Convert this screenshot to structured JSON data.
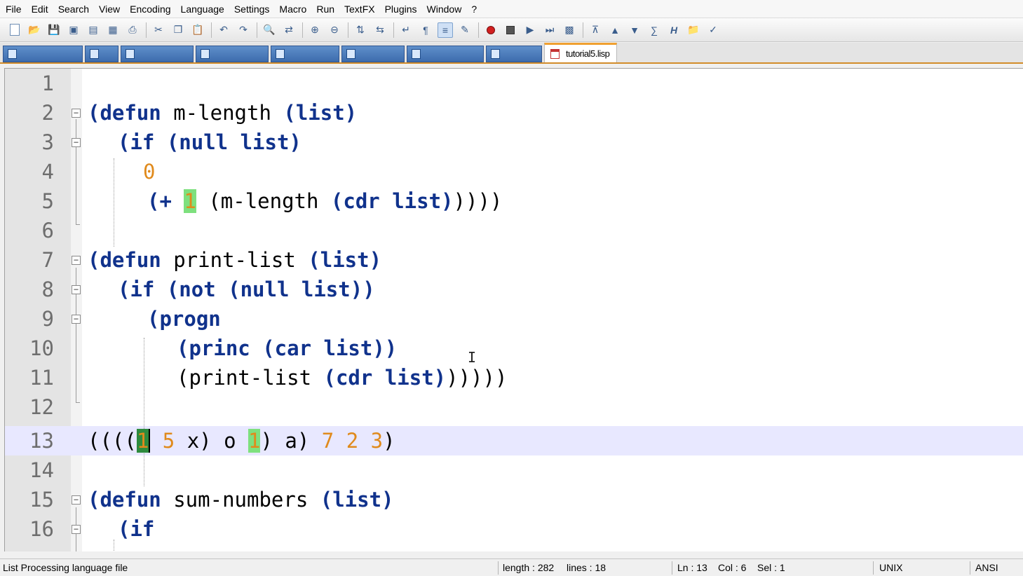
{
  "menubar": {
    "items": [
      "File",
      "Edit",
      "Search",
      "View",
      "Encoding",
      "Language",
      "Settings",
      "Macro",
      "Run",
      "TextFX",
      "Plugins",
      "Window",
      "?"
    ]
  },
  "tabs": {
    "active_label": "tutorial5.lisp"
  },
  "editor": {
    "lines": [
      {
        "n": "1"
      },
      {
        "n": "2"
      },
      {
        "n": "3"
      },
      {
        "n": "4"
      },
      {
        "n": "5"
      },
      {
        "n": "6"
      },
      {
        "n": "7"
      },
      {
        "n": "8"
      },
      {
        "n": "9"
      },
      {
        "n": "10"
      },
      {
        "n": "11"
      },
      {
        "n": "12"
      },
      {
        "n": "13"
      },
      {
        "n": "14"
      },
      {
        "n": "15"
      },
      {
        "n": "16"
      }
    ],
    "code": {
      "l2": {
        "open": "(defun",
        "name": " m-length ",
        "args": "(list)"
      },
      "l3": {
        "a": "(if (null list)"
      },
      "l4": {
        "a": "0"
      },
      "l5": {
        "a": "(+ ",
        "one": "1",
        "b": " (m-length ",
        "c": "(cdr list)",
        "d": "))))"
      },
      "l7": {
        "open": "(defun",
        "name": " print-list ",
        "args": "(list)"
      },
      "l8": {
        "a": "(if (not (null list))"
      },
      "l9": {
        "a": "(progn"
      },
      "l10": {
        "a": "(princ (car list))"
      },
      "l11": {
        "a": "(print-list ",
        "b": "(cdr list)",
        "c": ")))))"
      },
      "l13": {
        "a": "((((",
        "one": "1",
        "b": " ",
        "five": "5",
        "c": " x) o ",
        "one2": "1",
        "d": ") a) ",
        "seven": "7",
        "e": " ",
        "two": "2",
        "f": " ",
        "three": "3",
        "g": ")"
      },
      "l15": {
        "open": "(defun",
        "name": " sum-numbers ",
        "args": "(list)"
      },
      "l16": {
        "a": "(if"
      }
    },
    "current_line": 13
  },
  "statusbar": {
    "file_type": "List Processing language file",
    "length": "length : 282",
    "lines": "lines : 18",
    "ln": "Ln : 13",
    "col": "Col : 6",
    "sel": "Sel : 1",
    "eol": "UNIX",
    "encoding": "ANSI"
  },
  "colors": {
    "keyword": "#10328c",
    "number": "#e08a1c",
    "brace_match": "#7ee07e",
    "current_line": "#e8e8ff",
    "tab_accent": "#f0a030"
  }
}
